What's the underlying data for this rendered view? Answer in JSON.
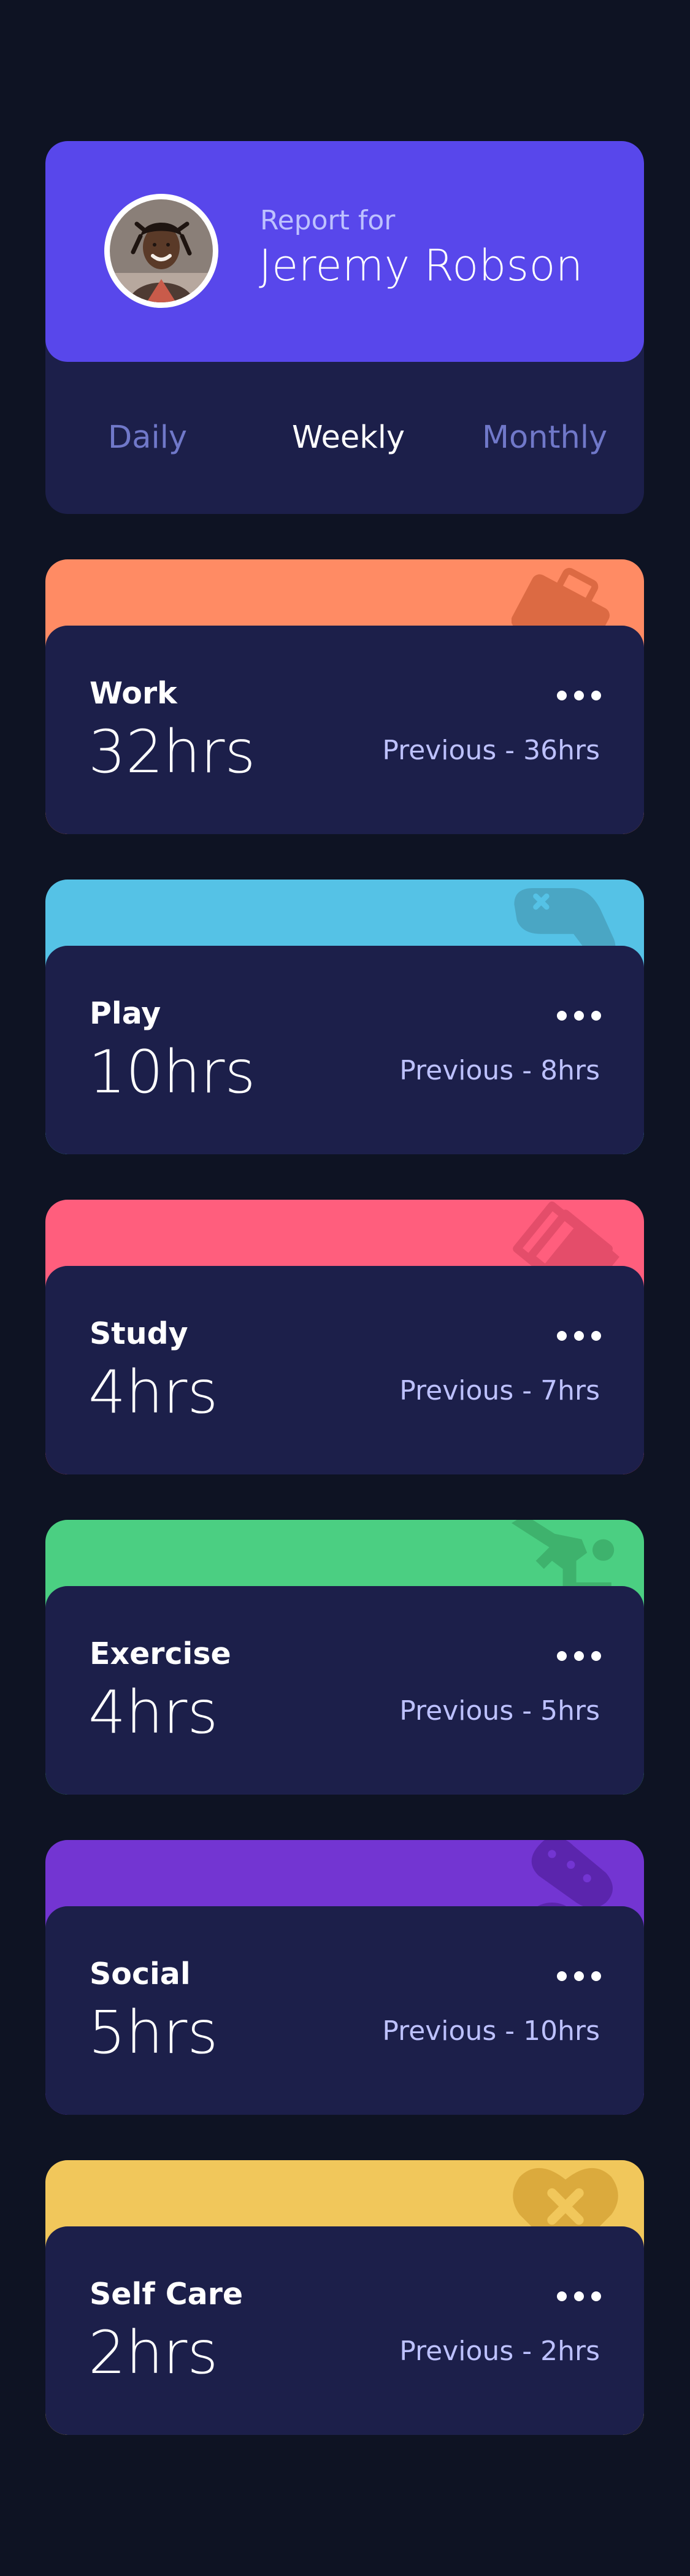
{
  "profile": {
    "report_label": "Report for",
    "name": "Jeremy Robson"
  },
  "tabs": [
    {
      "label": "Daily",
      "active": false
    },
    {
      "label": "Weekly",
      "active": true
    },
    {
      "label": "Monthly",
      "active": false
    }
  ],
  "cards": [
    {
      "title": "Work",
      "hours": "32hrs",
      "previous": "Previous - 36hrs",
      "color": "#ff8b64",
      "icon": "briefcase-icon"
    },
    {
      "title": "Play",
      "hours": "10hrs",
      "previous": "Previous - 8hrs",
      "color": "#55c2e6",
      "icon": "gamepad-icon"
    },
    {
      "title": "Study",
      "hours": "4hrs",
      "previous": "Previous - 7hrs",
      "color": "#ff5e7d",
      "icon": "books-icon"
    },
    {
      "title": "Exercise",
      "hours": "4hrs",
      "previous": "Previous - 5hrs",
      "color": "#4bcf82",
      "icon": "running-person-icon"
    },
    {
      "title": "Social",
      "hours": "5hrs",
      "previous": "Previous - 10hrs",
      "color": "#7335d2",
      "icon": "social-icon"
    },
    {
      "title": "Self Care",
      "hours": "2hrs",
      "previous": "Previous - 2hrs",
      "color": "#f1c75b",
      "icon": "heart-plus-icon"
    }
  ],
  "colors": {
    "background": "#0e1323",
    "card": "#1c1f4a",
    "accent": "#5847eb",
    "muted_text": "#bdc1ff",
    "inactive_tab": "#7078c9"
  }
}
